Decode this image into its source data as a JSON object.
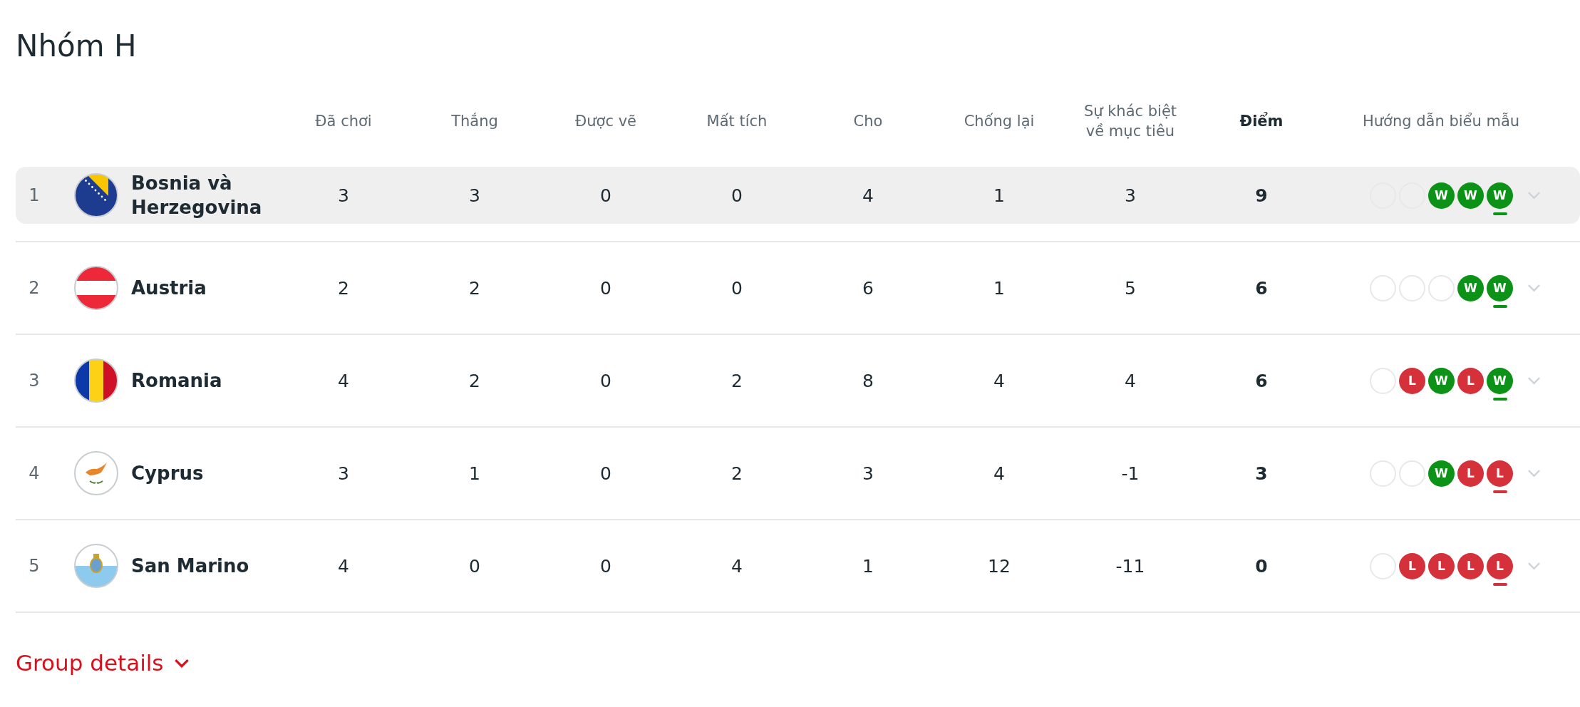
{
  "title": "Nhóm H",
  "columns": [
    {
      "label": "Đã chơi",
      "bold": false
    },
    {
      "label": "Thắng",
      "bold": false
    },
    {
      "label": "Được vẽ",
      "bold": false
    },
    {
      "label": "Mất tích",
      "bold": false
    },
    {
      "label": "Cho",
      "bold": false
    },
    {
      "label": "Chống lại",
      "bold": false
    },
    {
      "label": "Sự khác biệt về mục tiêu",
      "bold": false
    },
    {
      "label": "Điểm",
      "bold": true
    },
    {
      "label": "Hướng dẫn biểu mẫu",
      "bold": false
    }
  ],
  "rows": [
    {
      "rank": "1",
      "team": "Bosnia và Herzegovina",
      "selected": true,
      "stats": [
        "3",
        "3",
        "0",
        "0",
        "4",
        "1",
        "3"
      ],
      "points": "9",
      "form": [
        {
          "kind": "empty"
        },
        {
          "kind": "empty"
        },
        {
          "kind": "win",
          "label": "W"
        },
        {
          "kind": "win",
          "label": "W"
        },
        {
          "kind": "win",
          "label": "W"
        }
      ]
    },
    {
      "rank": "2",
      "team": "Austria",
      "selected": false,
      "stats": [
        "2",
        "2",
        "0",
        "0",
        "6",
        "1",
        "5"
      ],
      "points": "6",
      "form": [
        {
          "kind": "empty"
        },
        {
          "kind": "empty"
        },
        {
          "kind": "empty"
        },
        {
          "kind": "win",
          "label": "W"
        },
        {
          "kind": "win",
          "label": "W"
        }
      ]
    },
    {
      "rank": "3",
      "team": "Romania",
      "selected": false,
      "stats": [
        "4",
        "2",
        "0",
        "2",
        "8",
        "4",
        "4"
      ],
      "points": "6",
      "form": [
        {
          "kind": "empty"
        },
        {
          "kind": "loss",
          "label": "L"
        },
        {
          "kind": "win",
          "label": "W"
        },
        {
          "kind": "loss",
          "label": "L"
        },
        {
          "kind": "win",
          "label": "W"
        }
      ]
    },
    {
      "rank": "4",
      "team": "Cyprus",
      "selected": false,
      "stats": [
        "3",
        "1",
        "0",
        "2",
        "3",
        "4",
        "-1"
      ],
      "points": "3",
      "form": [
        {
          "kind": "empty"
        },
        {
          "kind": "empty"
        },
        {
          "kind": "win",
          "label": "W"
        },
        {
          "kind": "loss",
          "label": "L"
        },
        {
          "kind": "loss",
          "label": "L"
        }
      ]
    },
    {
      "rank": "5",
      "team": "San Marino",
      "selected": false,
      "stats": [
        "4",
        "0",
        "0",
        "4",
        "1",
        "12",
        "-11"
      ],
      "points": "0",
      "form": [
        {
          "kind": "empty"
        },
        {
          "kind": "loss",
          "label": "L"
        },
        {
          "kind": "loss",
          "label": "L"
        },
        {
          "kind": "loss",
          "label": "L"
        },
        {
          "kind": "loss",
          "label": "L"
        }
      ]
    }
  ],
  "details_link": "Group details"
}
